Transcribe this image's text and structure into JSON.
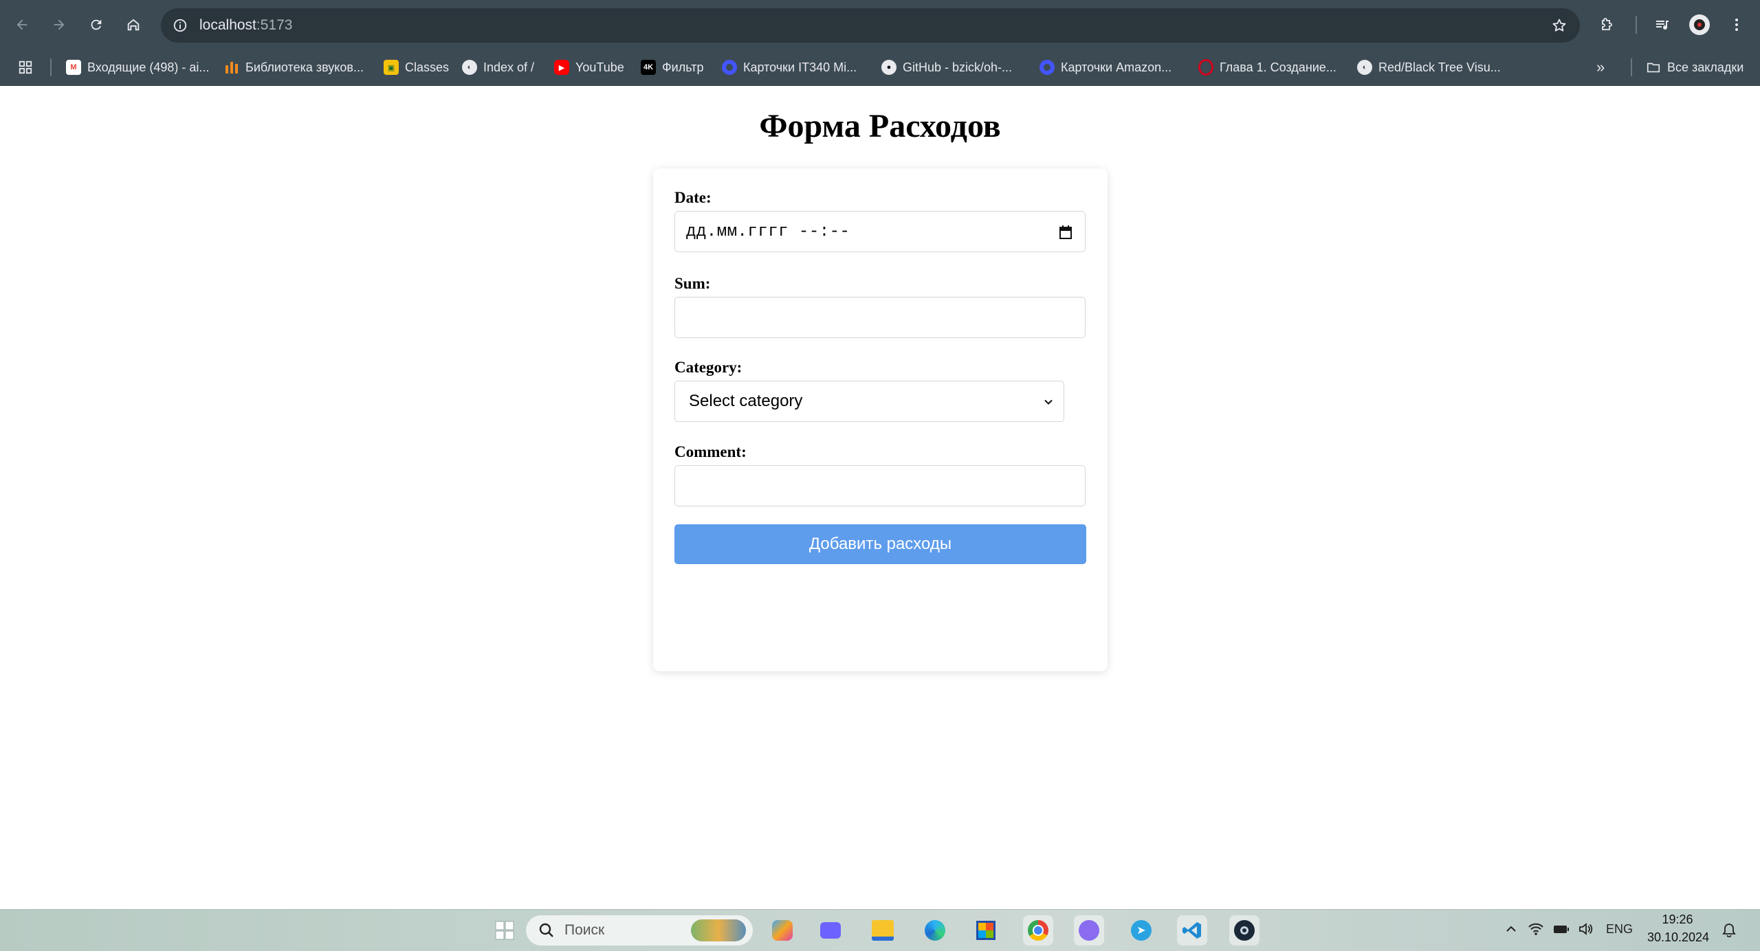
{
  "browser": {
    "url_host": "localhost",
    "url_port": ":5173",
    "bookmarks": [
      {
        "label": "Входящие (498) - ai...",
        "icon": "gmail-icon",
        "color": "#ea4335"
      },
      {
        "label": "Библиотека звуков...",
        "icon": "sound-library-icon",
        "color": "#f28b1e"
      },
      {
        "label": "Classes",
        "icon": "classes-icon",
        "color": "#f4c20d"
      },
      {
        "label": "Index of /",
        "icon": "globe-icon",
        "color": "#e8eaed"
      },
      {
        "label": "YouTube",
        "icon": "youtube-icon",
        "color": "#ff0000"
      },
      {
        "label": "Фильтр",
        "icon": "4k-icon",
        "color": "#000000"
      },
      {
        "label": "Карточки IT340 Mi...",
        "icon": "quizlet-icon",
        "color": "#4255ff"
      },
      {
        "label": "GitHub - bzick/oh-...",
        "icon": "github-icon",
        "color": "#e8eaed"
      },
      {
        "label": "Карточки Amazon...",
        "icon": "quizlet-icon",
        "color": "#4255ff"
      },
      {
        "label": "Глава 1. Создание...",
        "icon": "opera-icon",
        "color": "#d0021b"
      },
      {
        "label": "Red/Black Tree Visu...",
        "icon": "globe-icon",
        "color": "#e8eaed"
      }
    ],
    "all_bookmarks_label": "Все закладки"
  },
  "page": {
    "title": "Форма Расходов",
    "form": {
      "date_label": "Date:",
      "date_placeholder": "дд.мм.гггг --:--",
      "sum_label": "Sum:",
      "sum_value": "",
      "category_label": "Category:",
      "category_selected": "Select category",
      "comment_label": "Comment:",
      "comment_value": "",
      "submit_label": "Добавить расходы",
      "submit_color": "#5e9cec"
    }
  },
  "taskbar": {
    "search_placeholder": "Поиск",
    "language": "ENG",
    "time": "19:26",
    "date": "30.10.2024"
  }
}
